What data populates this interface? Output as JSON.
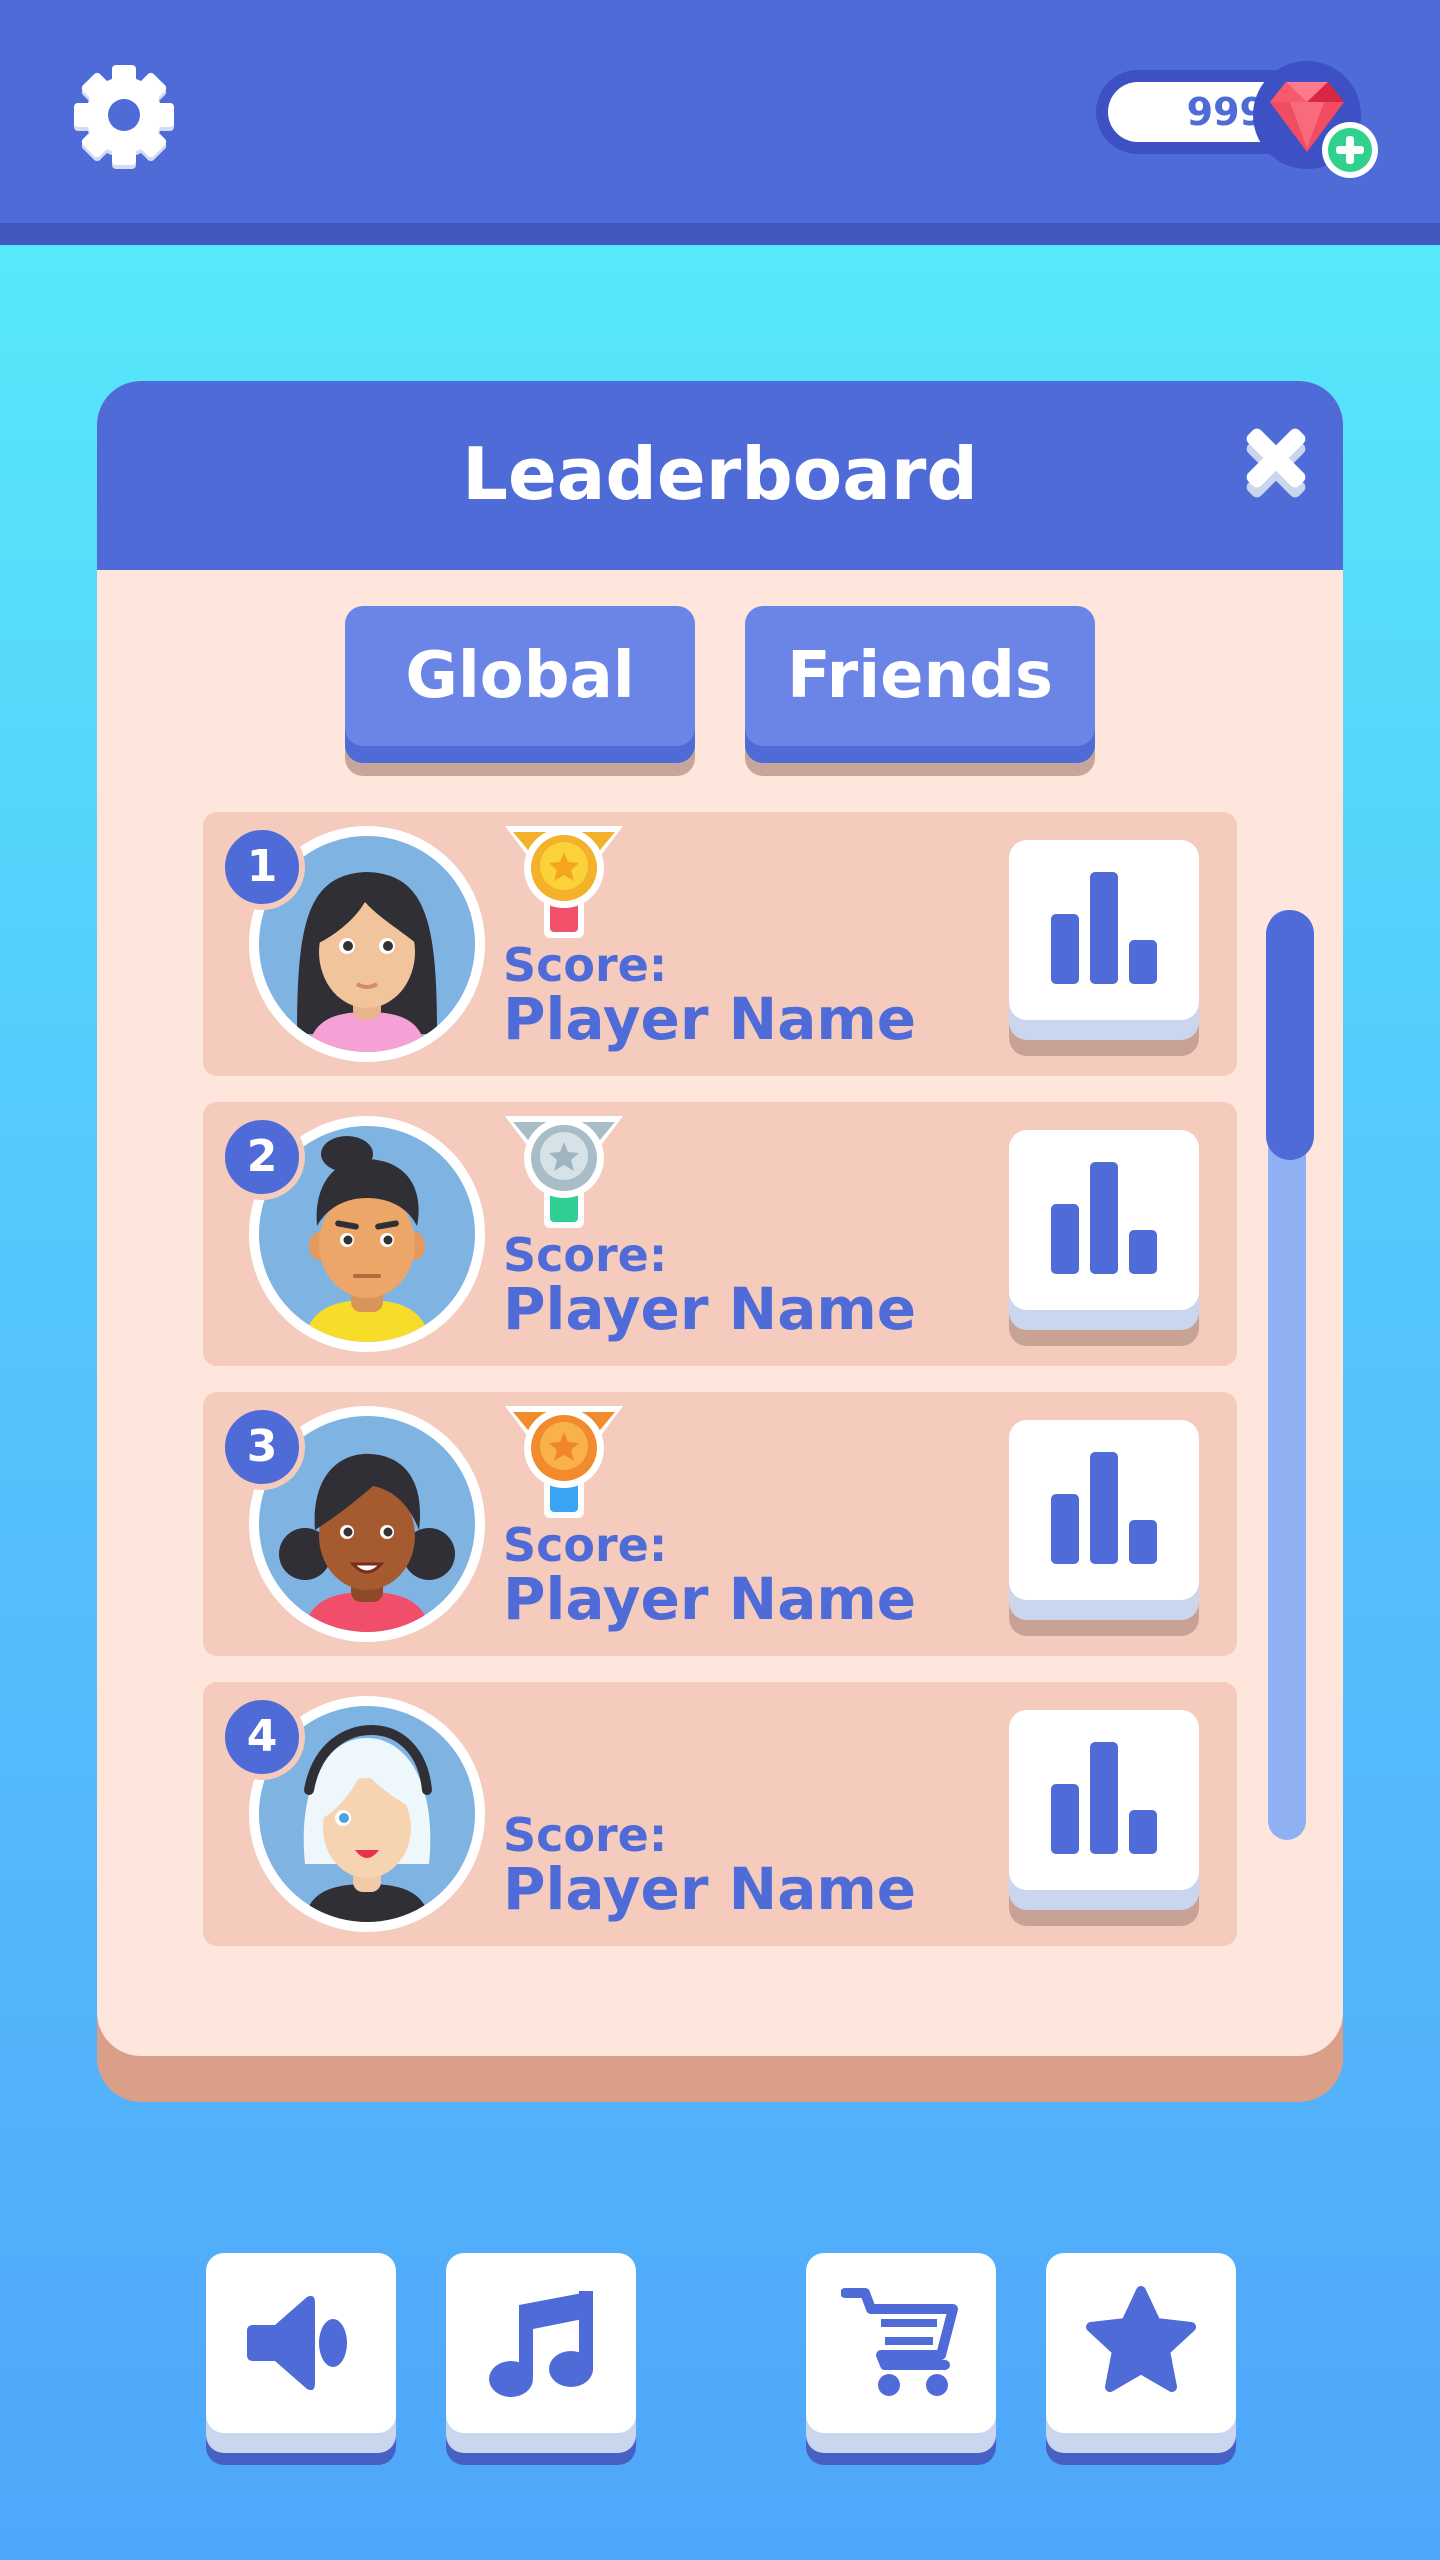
{
  "top_bar": {
    "settings_icon": "gear-icon",
    "gem_count": "999",
    "gem_icon": "ruby-gem-icon",
    "add_gems_icon": "plus-icon"
  },
  "leaderboard": {
    "title": "Leaderboard",
    "close_icon": "close-icon",
    "tabs": [
      {
        "label": "Global"
      },
      {
        "label": "Friends"
      }
    ],
    "rows": [
      {
        "rank": "1",
        "medal": "gold",
        "score_label": "Score:",
        "player_name": "Player Name"
      },
      {
        "rank": "2",
        "medal": "silver",
        "score_label": "Score:",
        "player_name": "Player Name"
      },
      {
        "rank": "3",
        "medal": "bronze",
        "score_label": "Score:",
        "player_name": "Player Name"
      },
      {
        "rank": "4",
        "medal": "",
        "score_label": "Score:",
        "player_name": "Player Name"
      }
    ],
    "row_button_icon": "bar-chart-icon"
  },
  "bottom_bar": {
    "buttons": [
      "sound-icon",
      "music-icon",
      "cart-icon",
      "star-icon"
    ]
  },
  "colors": {
    "primary": "#4f6bd7",
    "panel_bg": "#ffe6dc",
    "row_bg": "#f4cbbc",
    "gold": "#f9c12c",
    "silver": "#b7c9d3",
    "bronze": "#f5a03a"
  }
}
